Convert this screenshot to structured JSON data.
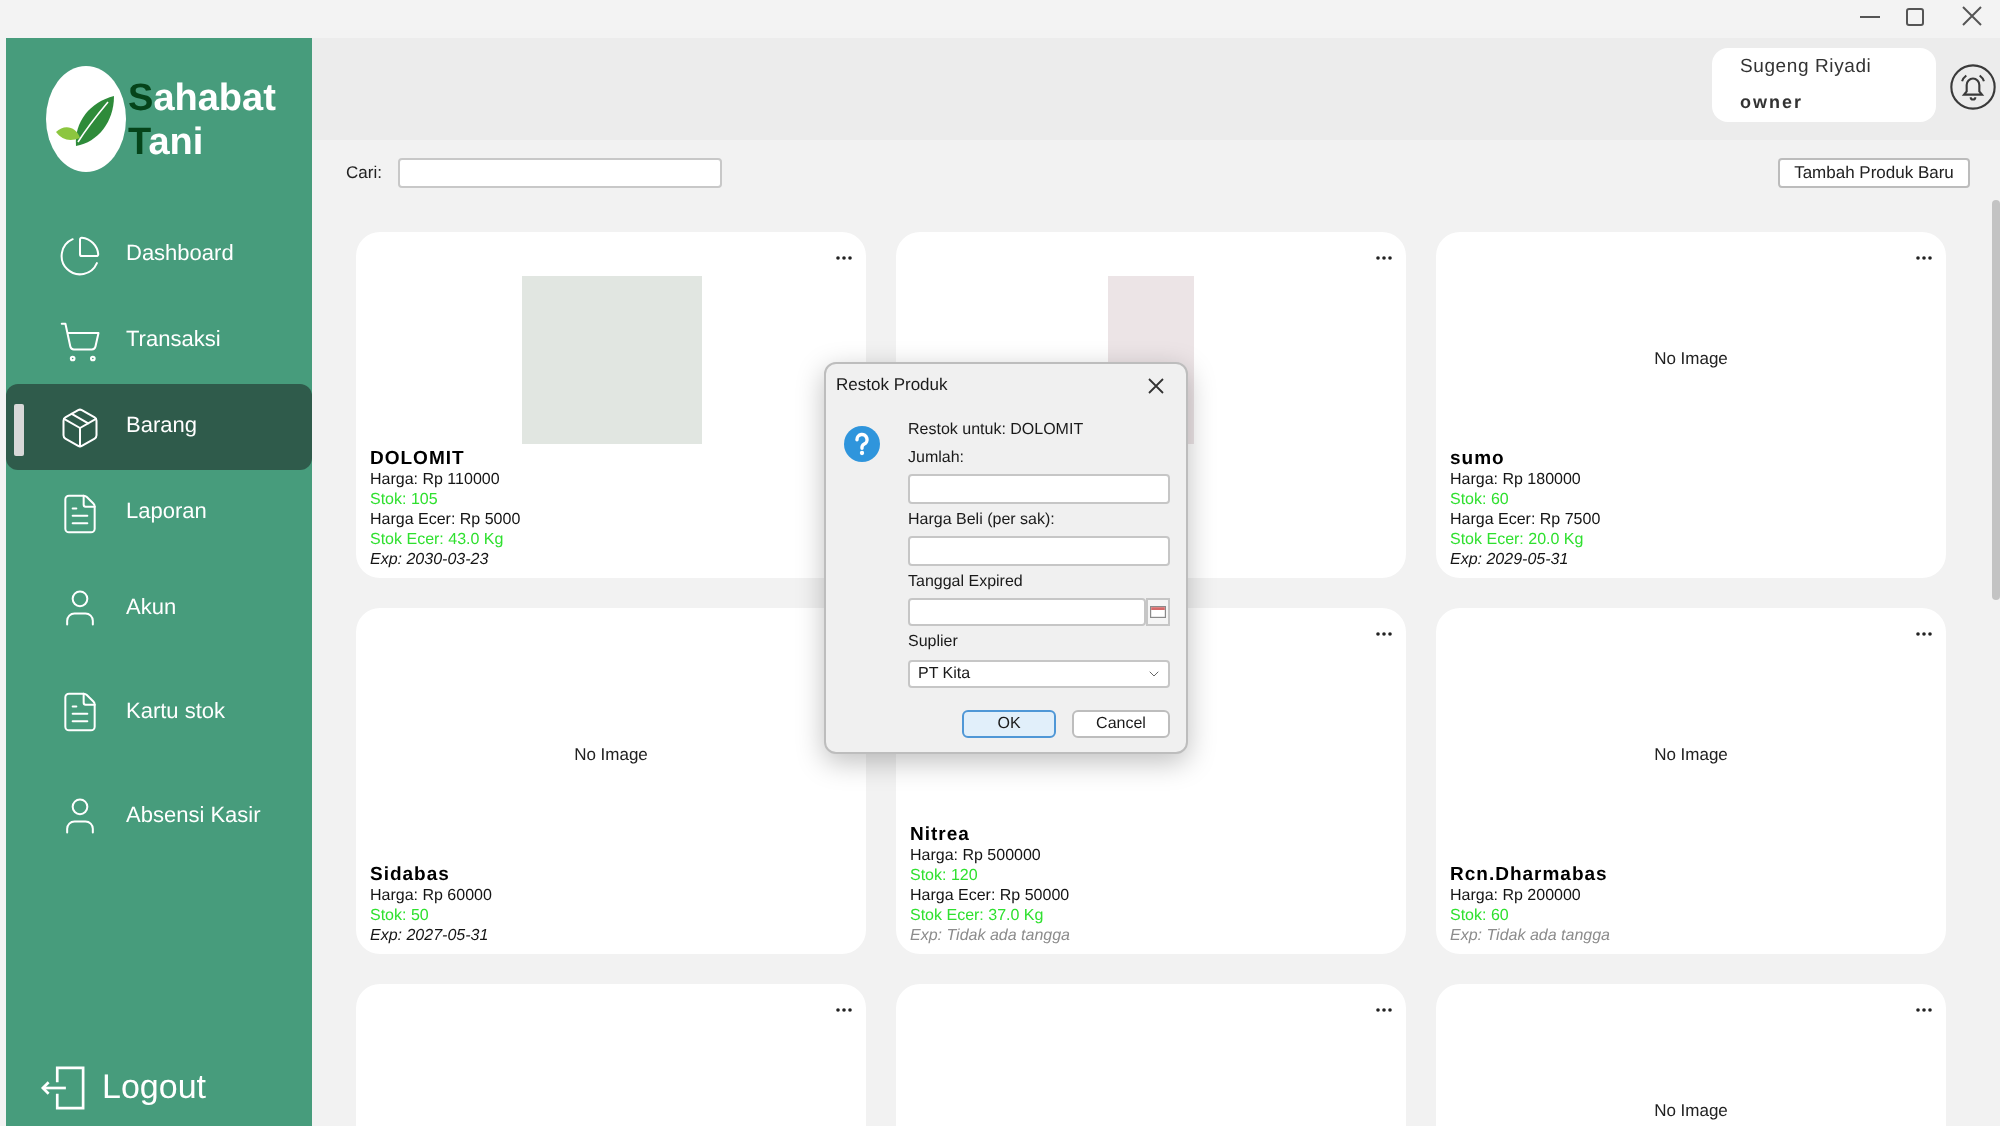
{
  "sidebar": {
    "brand": [
      {
        "accent": "S",
        "rest": "ahabat"
      },
      {
        "accent": "T",
        "rest": "ani"
      }
    ],
    "items": [
      {
        "label": "Dashboard",
        "selected": false
      },
      {
        "label": "Transaksi",
        "selected": false
      },
      {
        "label": "Barang",
        "selected": true
      },
      {
        "label": "Laporan",
        "selected": false
      },
      {
        "label": "Akun",
        "selected": false
      },
      {
        "label": "Kartu stok",
        "selected": false
      },
      {
        "label": "Absensi Kasir",
        "selected": false
      }
    ],
    "logout": "Logout"
  },
  "user": {
    "name": "Sugeng Riyadi",
    "role": "owner"
  },
  "search": {
    "label": "Cari:"
  },
  "add_button": "Tambah Produk Baru",
  "products": [
    {
      "image": {
        "kind": "photo"
      },
      "name": "DOLOMIT",
      "details": [
        {
          "kind": "price",
          "text": "Harga: Rp 110000"
        },
        {
          "kind": "stock",
          "text": "Stok: 105"
        },
        {
          "kind": "price",
          "text": "Harga Ecer: Rp 5000"
        },
        {
          "kind": "stock",
          "text": "Stok Ecer: 43.0 Kg"
        },
        {
          "kind": "expiry",
          "text": "Exp: 2030-03-23"
        }
      ]
    },
    {
      "image": {
        "kind": "portrait"
      }
    },
    {
      "image": {
        "kind": "none",
        "label": "No Image"
      },
      "name": "sumo",
      "details": [
        {
          "kind": "price",
          "text": "Harga: Rp 180000"
        },
        {
          "kind": "stock",
          "text": "Stok: 60"
        },
        {
          "kind": "price",
          "text": "Harga Ecer: Rp 7500"
        },
        {
          "kind": "stock",
          "text": "Stok Ecer: 20.0 Kg"
        },
        {
          "kind": "expiry",
          "text": "Exp: 2029-05-31"
        }
      ]
    },
    {
      "image": {
        "kind": "none",
        "label": "No Image"
      },
      "name": "Sidabas",
      "details": [
        {
          "kind": "price",
          "text": "Harga: Rp 60000"
        },
        {
          "kind": "stock",
          "text": "Stok: 50"
        },
        {
          "kind": "expiry",
          "text": "Exp: 2027-05-31"
        }
      ]
    },
    {
      "name": "Nitrea",
      "details": [
        {
          "kind": "price",
          "text": "Harga: Rp 500000"
        },
        {
          "kind": "stock",
          "text": "Stok: 120"
        },
        {
          "kind": "price",
          "text": "Harga Ecer: Rp 50000"
        },
        {
          "kind": "stock",
          "text": "Stok Ecer: 37.0 Kg"
        },
        {
          "kind": "missing",
          "text": "Exp: Tidak ada tangga"
        }
      ]
    },
    {
      "image": {
        "kind": "none",
        "label": "No Image"
      },
      "name": "Rcn.Dharmabas",
      "details": [
        {
          "kind": "price",
          "text": "Harga: Rp 200000"
        },
        {
          "kind": "stock",
          "text": "Stok: 60"
        },
        {
          "kind": "missing",
          "text": "Exp: Tidak ada tangga"
        }
      ]
    },
    {
      "image": {
        "kind": "none"
      }
    },
    {
      "image": {
        "kind": "none"
      }
    },
    {
      "image": {
        "kind": "none",
        "label": "No Image"
      }
    }
  ],
  "dialog": {
    "title": "Restok Produk",
    "message": "Restok untuk: DOLOMIT",
    "fields": [
      {
        "kind": "text",
        "label": "Jumlah:"
      },
      {
        "kind": "text",
        "label": "Harga Beli (per sak):"
      },
      {
        "kind": "date",
        "label": "Tanggal Expired"
      },
      {
        "kind": "select",
        "label": "Suplier",
        "value": "PT Kita"
      }
    ],
    "buttons": [
      {
        "label": "OK",
        "default": true
      },
      {
        "label": "Cancel",
        "default": false
      }
    ]
  }
}
